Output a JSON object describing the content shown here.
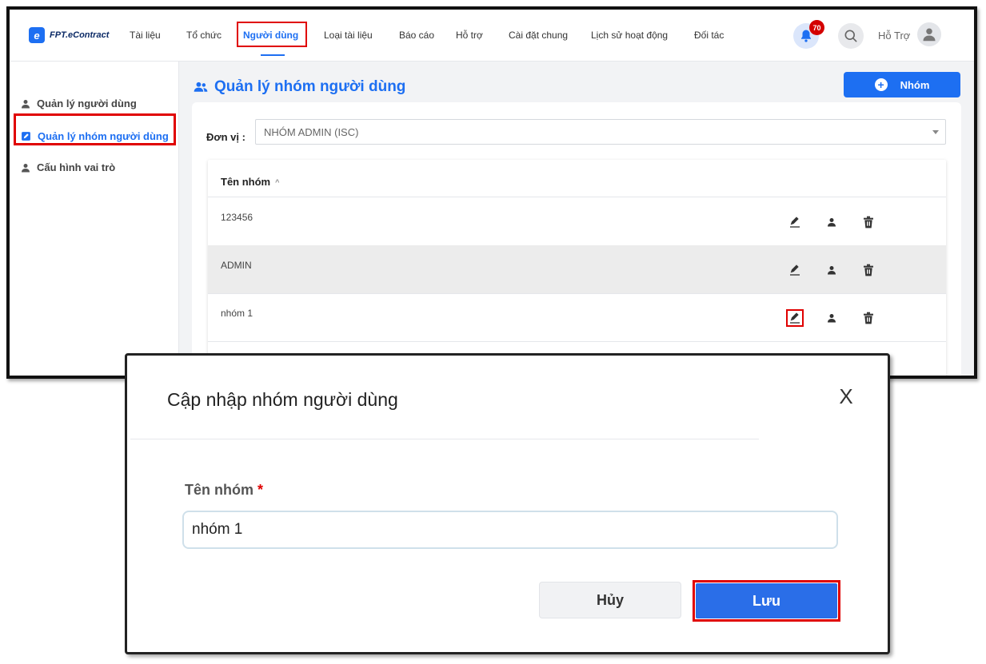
{
  "brand": {
    "logo_letter": "e",
    "name": "FPT.eContract"
  },
  "nav": {
    "items": [
      "Tài liệu",
      "Tổ chức",
      "Người dùng",
      "Loại tài liệu",
      "Báo cáo",
      "Hỗ trợ",
      "Cài đặt chung",
      "Lịch sử hoạt động",
      "Đối tác"
    ],
    "active": "Người dùng",
    "notification_count": "70",
    "user_name": "Hỗ Trợ"
  },
  "sidebar": {
    "items": [
      {
        "label": "Quản lý người dùng",
        "icon": "user-icon"
      },
      {
        "label": "Quản lý nhóm người dùng",
        "icon": "edit-doc-icon",
        "active": true
      },
      {
        "label": "Cấu hình vai trò",
        "icon": "user-icon"
      }
    ]
  },
  "page": {
    "title": "Quản lý nhóm người dùng",
    "add_button_label": "Nhóm",
    "unit_label": "Đơn vị :",
    "unit_value": "NHÓM ADMIN (ISC)"
  },
  "table": {
    "column_header": "Tên nhóm",
    "sort_indicator": "^",
    "rows": [
      {
        "name": "123456"
      },
      {
        "name": "ADMIN"
      },
      {
        "name": "nhóm 1"
      }
    ]
  },
  "modal": {
    "title": "Cập nhập nhóm người dùng",
    "close_label": "X",
    "field_label": "Tên nhóm",
    "required_mark": "*",
    "field_value": "nhóm 1",
    "cancel_label": "Hủy",
    "save_label": "Lưu"
  },
  "colors": {
    "primary": "#1d6ff2",
    "highlight": "#e00000",
    "badge": "#d40000"
  }
}
